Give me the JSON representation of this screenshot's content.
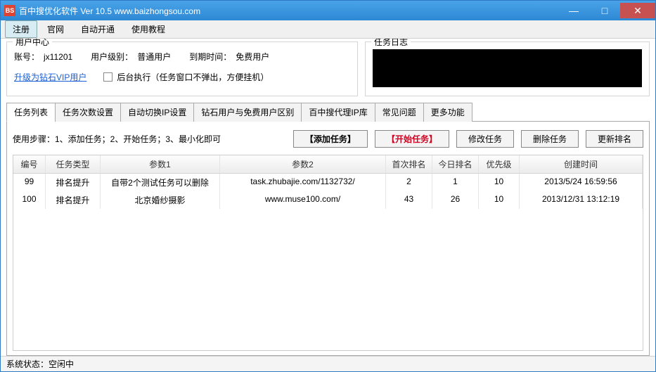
{
  "titlebar": {
    "icon_text": "BS",
    "title": "百中搜优化软件 Ver 10.5 www.baizhongsou.com"
  },
  "menu": {
    "items": [
      "注册",
      "官网",
      "自动开通",
      "使用教程"
    ]
  },
  "user_center": {
    "title": "用户中心",
    "account_label": "账号：",
    "account_value": "jx11201",
    "level_label": "用户级别：",
    "level_value": "普通用户",
    "expire_label": "到期时间：",
    "expire_value": "免费用户",
    "vip_link": "升级为钻石VIP用户",
    "bg_checkbox_label": "后台执行（任务窗口不弹出，方便挂机）"
  },
  "task_log": {
    "title": "任务日志"
  },
  "tabs": {
    "items": [
      "任务列表",
      "任务次数设置",
      "自动切换IP设置",
      "钻石用户与免费用户区别",
      "百中搜代理IP库",
      "常见问题",
      "更多功能"
    ]
  },
  "actions": {
    "instructions": "使用步骤：1、添加任务；2、开始任务；3、最小化即可",
    "add": "【添加任务】",
    "start": "【开始任务】",
    "edit": "修改任务",
    "delete": "删除任务",
    "refresh": "更新排名"
  },
  "table": {
    "headers": [
      "编号",
      "任务类型",
      "参数1",
      "参数2",
      "首次排名",
      "今日排名",
      "优先级",
      "创建时间"
    ],
    "rows": [
      {
        "id": "99",
        "type": "排名提升",
        "p1": "自带2个测试任务可以删除",
        "p2": "task.zhubajie.com/1132732/",
        "first": "2",
        "today": "1",
        "prio": "10",
        "created": "2013/5/24 16:59:56"
      },
      {
        "id": "100",
        "type": "排名提升",
        "p1": "北京婚纱摄影",
        "p2": "www.muse100.com/",
        "first": "43",
        "today": "26",
        "prio": "10",
        "created": "2013/12/31 13:12:19"
      }
    ]
  },
  "statusbar": {
    "label": "系统状态：",
    "value": "空闲中"
  }
}
